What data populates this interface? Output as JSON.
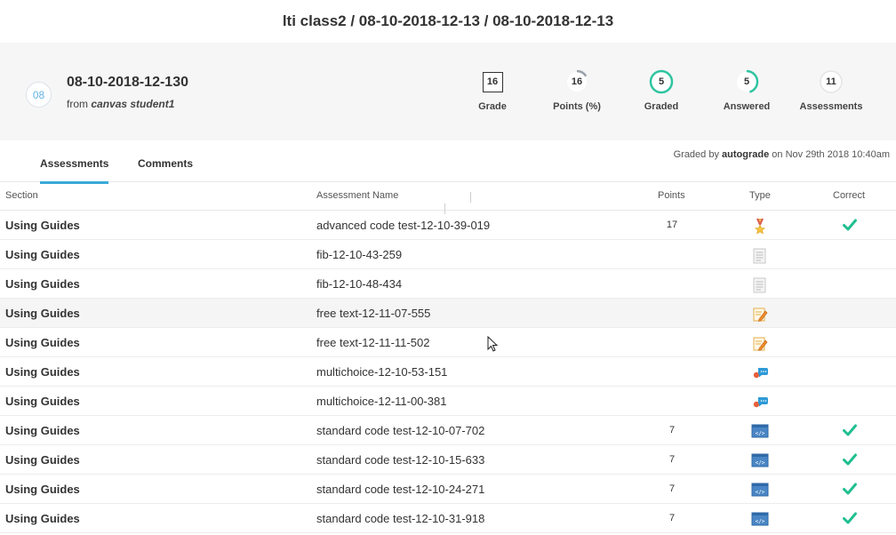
{
  "breadcrumb": "lti class2 / 08-10-2018-12-13 / 08-10-2018-12-13",
  "submission": {
    "avatar_text": "08",
    "title": "08-10-2018-12-130",
    "from_prefix": "from",
    "from_user": "canvas student1"
  },
  "stats": [
    {
      "value": "16",
      "label": "Grade"
    },
    {
      "value": "16",
      "label": "Points (%)",
      "fill": 0.16
    },
    {
      "value": "5",
      "label": "Graded",
      "fill": 1.0
    },
    {
      "value": "5",
      "label": "Answered",
      "fill": 0.45
    },
    {
      "value": "11",
      "label": "Assessments",
      "fill": 0
    }
  ],
  "tabs": [
    {
      "label": "Assessments",
      "active": true
    },
    {
      "label": "Comments",
      "active": false
    }
  ],
  "graded_by": {
    "prefix": "Graded by",
    "grader": "autograde",
    "suffix": "on Nov 29th 2018 10:40am"
  },
  "table": {
    "headers": [
      "Section",
      "Assessment Name",
      "Points",
      "Type",
      "Correct"
    ],
    "rows": [
      {
        "section": "Using Guides",
        "name": "advanced code test-12-10-39-019",
        "points": "17",
        "type": "medal-icon",
        "correct": true
      },
      {
        "section": "Using Guides",
        "name": "fib-12-10-43-259",
        "points": "",
        "type": "document-icon",
        "correct": false
      },
      {
        "section": "Using Guides",
        "name": "fib-12-10-48-434",
        "points": "",
        "type": "document-icon",
        "correct": false
      },
      {
        "section": "Using Guides",
        "name": "free text-12-11-07-555",
        "points": "",
        "type": "pencil-note-icon",
        "correct": false,
        "highlighted": true
      },
      {
        "section": "Using Guides",
        "name": "free text-12-11-11-502",
        "points": "",
        "type": "pencil-note-icon",
        "correct": false
      },
      {
        "section": "Using Guides",
        "name": "multichoice-12-10-53-151",
        "points": "",
        "type": "chat-bubbles-icon",
        "correct": false
      },
      {
        "section": "Using Guides",
        "name": "multichoice-12-11-00-381",
        "points": "",
        "type": "chat-bubbles-icon",
        "correct": false
      },
      {
        "section": "Using Guides",
        "name": "standard code test-12-10-07-702",
        "points": "7",
        "type": "code-icon",
        "correct": true
      },
      {
        "section": "Using Guides",
        "name": "standard code test-12-10-15-633",
        "points": "7",
        "type": "code-icon",
        "correct": true
      },
      {
        "section": "Using Guides",
        "name": "standard code test-12-10-24-271",
        "points": "7",
        "type": "code-icon",
        "correct": true
      },
      {
        "section": "Using Guides",
        "name": "standard code test-12-10-31-918",
        "points": "7",
        "type": "code-icon",
        "correct": true
      }
    ]
  },
  "colors": {
    "accent": "#3aa9d9",
    "ring_green": "#2ec4a0",
    "check_green": "#1fbf8f",
    "ring_gray": "#9aa3ab"
  }
}
